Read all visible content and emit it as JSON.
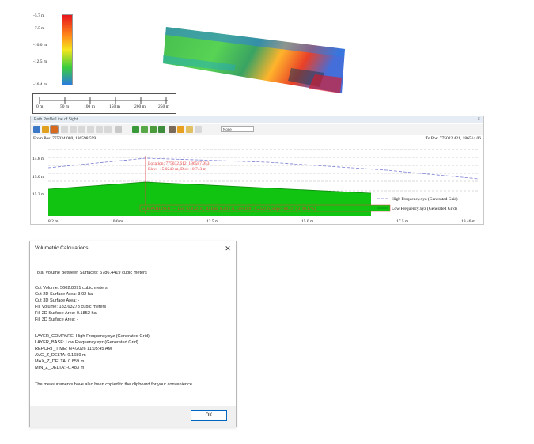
{
  "legend": {
    "labels": [
      "-5.7 m",
      "-7.5 m",
      "-10.0 m",
      "-12.5 m",
      "-16.4 m"
    ]
  },
  "scalebar": {
    "labels": [
      "0 m",
      "50 m",
      "100 m",
      "150 m",
      "200 m",
      "250 m"
    ]
  },
  "profile": {
    "title": "Path Profile/Line of Sight",
    "close_glyph": "×",
    "zoom_value": "None",
    "from_pos": "From Pos: 775034.080, 186598.599",
    "to_pos": "To Pos: 775022.421, 186514.06",
    "y_labels": [
      "14.8 m",
      "15.0 m",
      "15.2 m"
    ],
    "x_labels": [
      "8.2 m",
      "10.0 m",
      "12.5 m",
      "15.0 m",
      "17.5 m",
      "19.46 m"
    ],
    "cursor_location": "Location: 775032.612, 186587.953",
    "cursor_elev": "Elev: -15.0249 m, Dist: 10.743 m",
    "sub_path_info": "SUB-PATH INFO ---- Dist: 0.00729 m, 3D Dist: 0.2311 m, Elev Diff: -0.2329 m, Slope: -88.21° (-3190.17%)",
    "legend": [
      "High Frequency.xyz (Generated Grid)",
      "Low Frequency.xyz (Generated Grid)"
    ]
  },
  "dialog": {
    "title": "Volumetric Calculations",
    "close_glyph": "✕",
    "total": "Total Volume Between Surfaces: 5786.4419 cubic meters",
    "cut_volume": "Cut Volume: 5602.8091 cubic meters",
    "cut_2d": "Cut 2D Surface Area: 3.02 ha",
    "cut_3d": "Cut 3D Surface Area: -",
    "fill_volume": "Fill Volume: 183.63273 cubic meters",
    "fill_2d": "Fill 2D Surface Area: 0.1852 ha",
    "fill_3d": "Fill 3D Surface Area: -",
    "layer_compare": "LAYER_COMPARE: High Frequency.xyz (Generated Grid)",
    "layer_base": "LAYER_BASE: Low Frequency.xyz (Generated Grid)",
    "report_time": "REPORT_TIME: 6/4/2026 11:05:45 AM",
    "avg": "AVG_Z_DELTA: 0.1689 m",
    "max": "MAX_Z_DELTA: 0.859 m",
    "min": "MIN_Z_DELTA: -0.483 m",
    "note": "The measurements have also been copied to the clipboard for your convenience.",
    "ok_label": "OK"
  },
  "colors": {
    "fill_green": "#11c411",
    "dialog_accent": "#0067c0",
    "profile_line_blue": "#7a7fd6",
    "cursor_red": "#e03a3a"
  }
}
